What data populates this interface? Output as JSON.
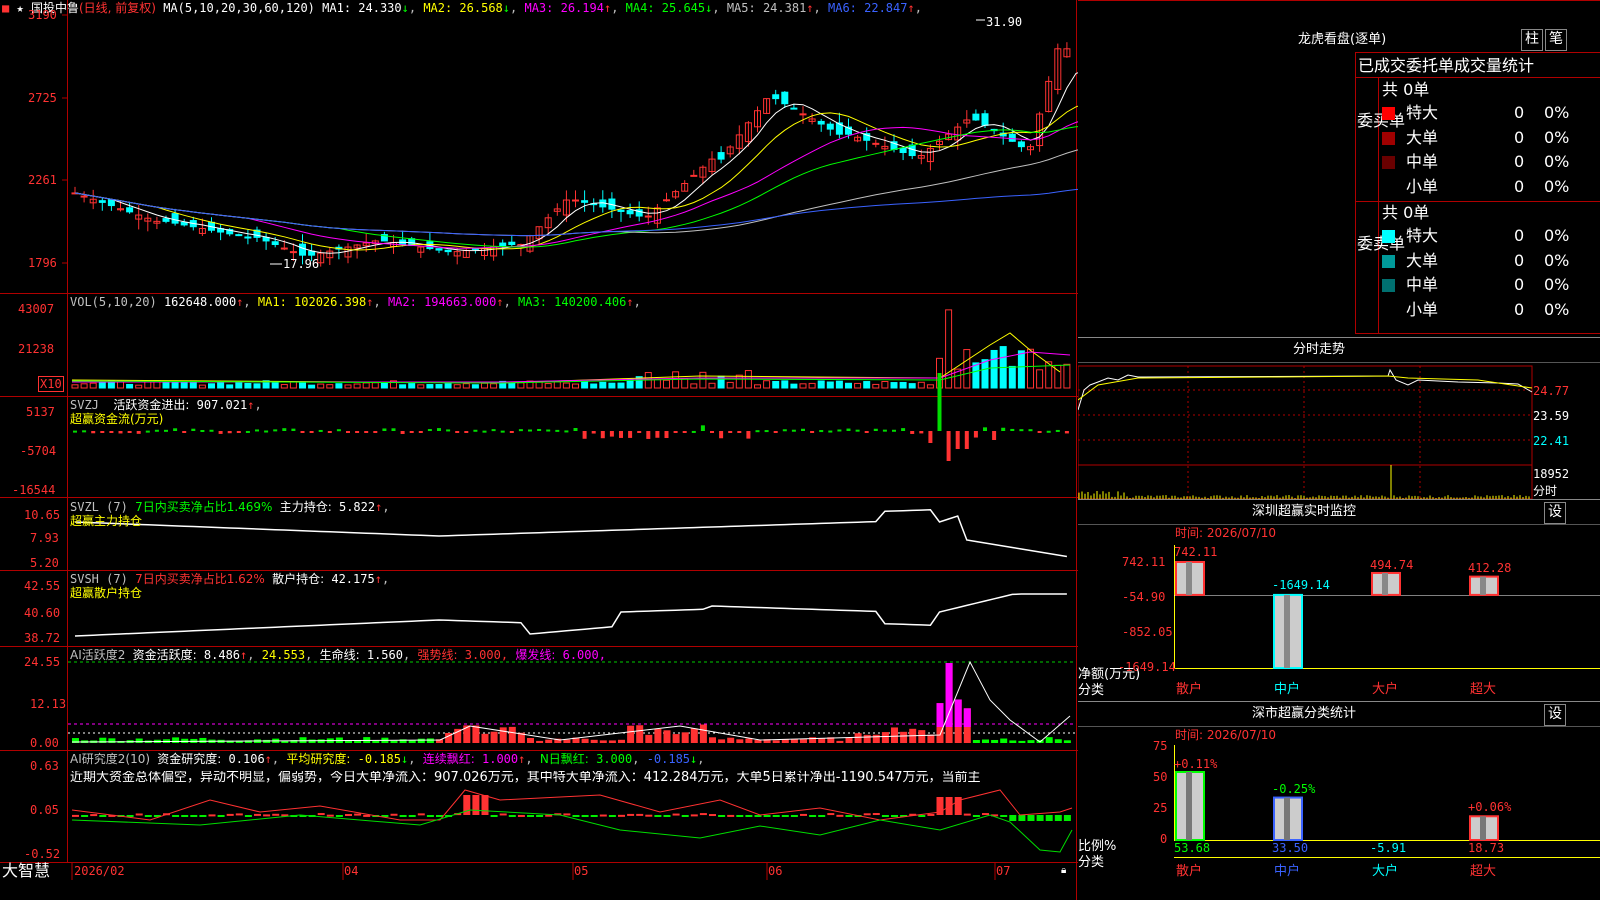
{
  "app": {
    "brand": "大智慧"
  },
  "header": {
    "stock_name": "国投中鲁",
    "period": "(日线, 前复权)",
    "ma_label": "MA(5,10,20,30,60,120)",
    "ma_items": [
      {
        "label": "MA1:",
        "value": "24.330",
        "arrow": "↓",
        "color": "#ffffff"
      },
      {
        "label": "MA2:",
        "value": "26.568",
        "arrow": "↓",
        "color": "#ffff00"
      },
      {
        "label": "MA3:",
        "value": "26.194",
        "arrow": "↑",
        "color": "#ff00ff"
      },
      {
        "label": "MA4:",
        "value": "25.645",
        "arrow": "↓",
        "color": "#00ff00"
      },
      {
        "label": "MA5:",
        "value": "24.381",
        "arrow": "↑",
        "color": "#c0c0c0"
      },
      {
        "label": "MA6:",
        "value": "22.847",
        "arrow": "↑",
        "color": "#3a62ff"
      }
    ]
  },
  "price_axis": [
    "3190",
    "2725",
    "2261",
    "1796"
  ],
  "price_annotations": {
    "high": "31.90",
    "low": "17.96"
  },
  "vol": {
    "title": "VOL(5,10,20)",
    "value": "162648.000",
    "arrow": "↑",
    "items": [
      {
        "label": "MA1:",
        "value": "102026.398",
        "arrow": "↑",
        "color": "#ffff00"
      },
      {
        "label": "MA2:",
        "value": "194663.000",
        "arrow": "↑",
        "color": "#ff00ff"
      },
      {
        "label": "MA3:",
        "value": "140200.406",
        "arrow": "↑",
        "color": "#00ff00"
      }
    ],
    "axis": [
      "43007",
      "21238"
    ],
    "multiplier": "X10"
  },
  "svzj": {
    "line1_name": "SVZJ",
    "line1_label": "活跃资金进出:",
    "line1_value": "907.021",
    "line1_arrow": "↑",
    "line2": "超赢资金流(万元)",
    "axis": [
      "5137",
      "-5704",
      "-16544"
    ]
  },
  "svzl": {
    "name": "SVZL",
    "param": "(7)",
    "ratio_text": "7日内买卖净占比1.469%",
    "hold_label": "主力持仓:",
    "hold_value": "5.822",
    "hold_arrow": "↑",
    "line2": "超赢主力持仓",
    "axis": [
      "10.65",
      "7.93",
      "5.20"
    ]
  },
  "svsh": {
    "name": "SVSH",
    "param": "(7)",
    "ratio_text": "7日内买卖净占比1.62%",
    "hold_label": "散户持仓:",
    "hold_value": "42.175",
    "hold_arrow": "↑",
    "line2": "超赢散户持仓",
    "axis": [
      "42.55",
      "40.60",
      "38.72"
    ]
  },
  "ai_active": {
    "title": "AI活跃度2",
    "label1": "资金活跃度:",
    "value1": "8.486",
    "arrow1": "↑",
    "value2": "24.553",
    "label3": "生命线:",
    "value3": "1.560",
    "label4": "强势线:",
    "value4": "3.000",
    "label5": "爆发线:",
    "value5": "6.000",
    "axis": [
      "24.55",
      "12.13",
      "0.00"
    ]
  },
  "ai_research": {
    "title": "AI研究度2(10)",
    "label1": "资金研究度:",
    "value1": "0.106",
    "arrow1": "↑",
    "label2": "平均研究度:",
    "value2": "-0.185",
    "arrow2": "↓",
    "label3": "连续飘红:",
    "value3": "1.000",
    "arrow3": "↑",
    "label4": "N日飘红:",
    "value4": "3.000",
    "value5": "-0.185",
    "arrow5": "↓",
    "commentary": "近期大资金总体偏空，异动不明显，偏弱势，今日大单净流入：907.026万元，其中特大单净流入：412.284万元，大单5日累计净出-1190.547万元，当前主",
    "axis": [
      "0.63",
      "0.05",
      "-0.52"
    ]
  },
  "date_axis": [
    "2026/02",
    "04",
    "05",
    "06",
    "07"
  ],
  "right_panel": {
    "dragon_title": "龙虎看盘(逐单)",
    "btn_zhu": "柱",
    "btn_bi": "笔",
    "tabs": [
      "已成交",
      "委托单",
      "成交量统计"
    ],
    "buy": {
      "side_label": "委买单",
      "count_text": "共 0单",
      "rows": [
        {
          "label": "特大",
          "count": "0",
          "pct": "0%",
          "color": "#ff0000"
        },
        {
          "label": "大单",
          "count": "0",
          "pct": "0%",
          "color": "#a00000"
        },
        {
          "label": "中单",
          "count": "0",
          "pct": "0%",
          "color": "#6a0000"
        },
        {
          "label": "小单",
          "count": "0",
          "pct": "0%",
          "color": "#000000"
        }
      ]
    },
    "sell": {
      "side_label": "委卖单",
      "count_text": "共 0单",
      "rows": [
        {
          "label": "特大",
          "count": "0",
          "pct": "0%",
          "color": "#00ffff"
        },
        {
          "label": "大单",
          "count": "0",
          "pct": "0%",
          "color": "#009a9a"
        },
        {
          "label": "中单",
          "count": "0",
          "pct": "0%",
          "color": "#007070"
        },
        {
          "label": "小单",
          "count": "0",
          "pct": "0%",
          "color": "#000000"
        }
      ]
    },
    "intraday": {
      "title": "分时走势",
      "axis": [
        "24.77",
        "23.59",
        "22.41",
        "18952"
      ],
      "unit": "分时"
    },
    "monitor": {
      "title": "深圳超赢实时监控",
      "settings": "设",
      "time_label": "时间: 2026/07/10",
      "ylabel1": "净额(万元)",
      "ylabel2": "分类",
      "axis": [
        "742.11",
        "-54.90",
        "-852.05",
        "-1649.14"
      ],
      "categories": [
        "散户",
        "中户",
        "大户",
        "超大"
      ],
      "values": [
        "742.11",
        "-1649.14",
        "494.74",
        "412.28"
      ]
    },
    "stats": {
      "title": "深市超赢分类统计",
      "settings": "设",
      "time_label": "时间: 2026/07/10",
      "ylabel1": "比例%",
      "ylabel2": "分类",
      "axis": [
        "75",
        "50",
        "25",
        "0"
      ],
      "categories": [
        "散户",
        "中户",
        "大户",
        "超大"
      ],
      "top_values": [
        "+0.11%",
        "-0.25%",
        "",
        "+0.06%"
      ],
      "bottom_values": [
        "53.68",
        "33.50",
        "-5.91",
        "18.73"
      ]
    }
  },
  "colors": {
    "up": "#ff3232",
    "down": "#00ffff",
    "grid": "#b00000",
    "bg": "#000000"
  },
  "chart_data": {
    "type": "candlestick",
    "categories": [
      "2026/02",
      "04",
      "05",
      "06",
      "07"
    ],
    "price_range": [
      1796,
      3190
    ],
    "high": 31.9,
    "low": 17.96,
    "monitor_bars": {
      "categories": [
        "散户",
        "中户",
        "大户",
        "超大"
      ],
      "values": [
        742.11,
        -1649.14,
        494.74,
        412.28
      ]
    },
    "stats_bars": {
      "categories": [
        "散户",
        "中户",
        "大户",
        "超大"
      ],
      "values": [
        53.68,
        33.5,
        -5.91,
        18.73
      ]
    }
  }
}
